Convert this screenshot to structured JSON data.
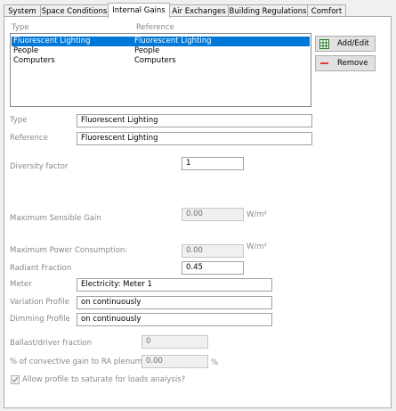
{
  "tabs": [
    "System",
    "Space Conditions",
    "Internal Gains",
    "Air Exchanges",
    "Building Regulations",
    "Comfort"
  ],
  "list": {
    "col_type": "Type",
    "col_reference": "Reference",
    "rows": [
      {
        "type": "Fluorescent Lighting",
        "reference": "Fluorescent Lighting"
      },
      {
        "type": "People",
        "reference": "People"
      },
      {
        "type": "Computers",
        "reference": "Computers"
      }
    ]
  },
  "buttons": {
    "add_edit": "Add/Edit",
    "remove": "Remove"
  },
  "form": {
    "type_label": "Type",
    "type_value": "Fluorescent Lighting",
    "reference_label": "Reference",
    "reference_value": "Fluorescent Lighting",
    "diversity_label": "Diversity factor",
    "diversity_value": "1",
    "max_sensible_label": "Maximum Sensible Gain",
    "max_sensible_value": "0.00",
    "max_sensible_unit": "W/m²",
    "max_power_label": "Maximum Power Consumption:",
    "max_power_value": "0.00",
    "max_power_unit": "W/m²",
    "radiant_label": "Radiant Fraction",
    "radiant_value": "0.45",
    "meter_label": "Meter",
    "meter_value": "Electricity: Meter 1",
    "variation_label": "Variation Profile",
    "variation_value": "on continuously",
    "dimming_label": "Dimming Profile",
    "dimming_value": "on continuously",
    "ballast_label": "Ballast/driver fraction",
    "ballast_value": "0",
    "convective_label": "% of convective gain to RA plenum",
    "convective_value": "0.00",
    "convective_unit": "%",
    "allow_label": "Allow profile to saturate for loads analysis?",
    "allow_checked": true
  },
  "colors": {
    "selection": "#0078d7",
    "add_icon": "#2e7d32",
    "remove_icon": "#e53935"
  },
  "icons": {
    "add": "grid-add-icon",
    "remove": "minus-icon",
    "check": "checkmark-icon"
  }
}
